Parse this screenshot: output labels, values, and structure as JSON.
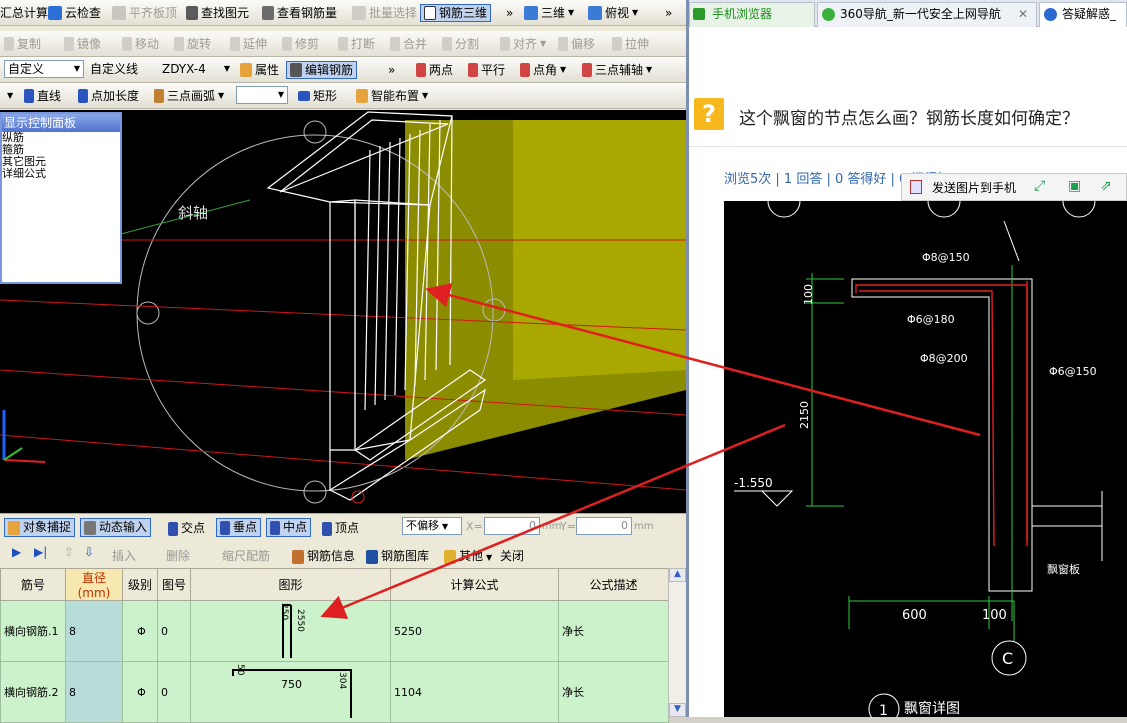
{
  "toolbar1": {
    "items": [
      "汇总计算",
      "云检查",
      "平齐板顶",
      "查找图元",
      "查看钢筋量",
      "批量选择",
      "钢筋三维",
      "三维",
      "俯视"
    ]
  },
  "toolbar2": {
    "items": [
      "复制",
      "镜像",
      "移动",
      "旋转",
      "延伸",
      "修剪",
      "打断",
      "合并",
      "分割",
      "对齐",
      "偏移",
      "拉伸"
    ]
  },
  "toolbar3": {
    "combo1": "自定义",
    "combo2": "自定义线",
    "combo3": "ZDYX-4",
    "items": [
      "属性",
      "编辑钢筋",
      "两点",
      "平行",
      "点角",
      "三点辅轴"
    ]
  },
  "toolbar4": {
    "items": [
      "直线",
      "点加长度",
      "三点画弧",
      "矩形",
      "智能布置"
    ]
  },
  "panel": {
    "title": "显示控制面板",
    "lines": [
      "纵筋",
      "箍筋",
      "其它图元",
      "详细公式"
    ]
  },
  "viewport": {
    "axis_label": "斜轴"
  },
  "snap": {
    "items": [
      "对象捕捉",
      "动态输入",
      "交点",
      "垂点",
      "中点",
      "顶点"
    ],
    "offset": "不偏移",
    "x_label": "X=",
    "x_value": "0",
    "y_label": "Y=",
    "y_value": "0",
    "unit": "mm"
  },
  "edit": {
    "items": [
      "插入",
      "删除",
      "缩尺配筋",
      "钢筋信息",
      "钢筋图库",
      "其他",
      "关闭"
    ]
  },
  "grid": {
    "headers": [
      "筋号",
      "直径(mm)",
      "级别",
      "图号",
      "图形",
      "计算公式",
      "公式描述"
    ],
    "rows": [
      {
        "name": "横向钢筋.1",
        "dia": "8",
        "grade": "Φ",
        "fig": "0",
        "shape_top": "250",
        "shape_side": "2550",
        "formula": "5250",
        "desc": "净长"
      },
      {
        "name": "横向钢筋.2",
        "dia": "8",
        "grade": "Φ",
        "fig": "0",
        "shape_left": "50",
        "shape_mid": "750",
        "shape_right": "304",
        "formula": "1104",
        "desc": "净长"
      }
    ]
  },
  "browser": {
    "tabs": [
      "手机浏览器",
      "360导航_新一代安全上网导航",
      "答疑解惑_"
    ],
    "question": "这个飘窗的节点怎么画？钢筋长度如何确定？",
    "stats": "浏览5次 | 1 回答 | 0 答得好 | 0 问得好",
    "send_phone": "发送图片到手机"
  },
  "cad": {
    "labels": [
      "Φ8@150",
      "Φ6@180",
      "Φ8@200",
      "Φ6@150",
      "100",
      "2150",
      "-1.550",
      "600",
      "100",
      "C",
      "飘窗详图",
      "飘窗板"
    ],
    "detail_no": "1"
  },
  "colors": {
    "yellow": "#8c8c00",
    "red": "#e02020",
    "grid_bg": "#ccf2cc"
  }
}
